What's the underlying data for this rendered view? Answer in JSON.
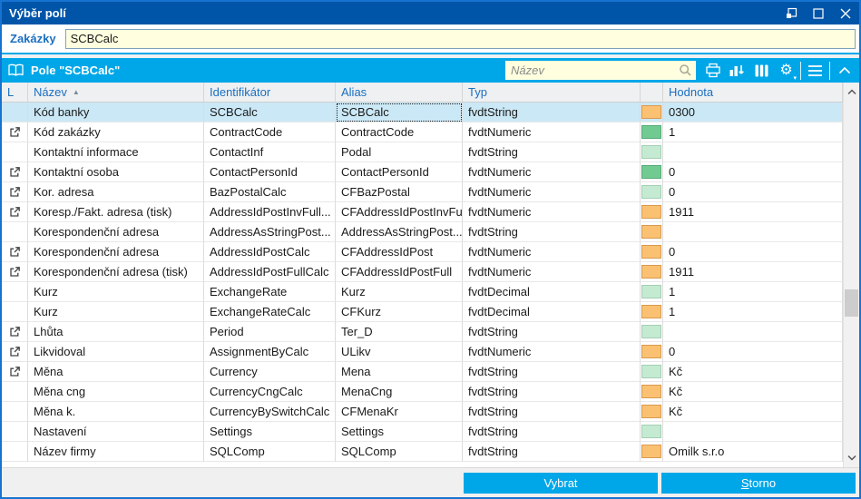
{
  "window": {
    "title": "Výběr polí"
  },
  "params": {
    "label": "Zakázky",
    "value": "SCBCalc"
  },
  "toolbar": {
    "panel_title": "Pole \"SCBCalc\"",
    "search_placeholder": "Název"
  },
  "buttons": {
    "vybrat": "Vybrat",
    "storno": "Storno"
  },
  "colors": {
    "window_border": "#1673d1",
    "titlebar": "#0055a9",
    "toolbar": "#00a7e8",
    "input_bg": "#ffffdf",
    "header_text": "#1b6fc0",
    "selected_row": "#cbe8f6",
    "swatches": {
      "orange": {
        "fill": "#fac172",
        "border": "#d99a4e"
      },
      "green": {
        "fill": "#72ca93",
        "border": "#55ab77"
      },
      "lightgreen": {
        "fill": "#c4ead2",
        "border": "#a4cfb4"
      }
    }
  },
  "table": {
    "headers": {
      "l": "L",
      "nazev": "Název",
      "identifikator": "Identifikátor",
      "alias": "Alias",
      "typ": "Typ",
      "hodnota": "Hodnota"
    },
    "sort": {
      "column": "Název",
      "direction": "ascending"
    },
    "rows": [
      {
        "link": false,
        "nazev": "Kód banky",
        "identifikator": "SCBCalc",
        "alias": "SCBCalc",
        "typ": "fvdtString",
        "swatch": "orange",
        "hodnota": "0300",
        "selected": true,
        "focused_cell": "alias"
      },
      {
        "link": true,
        "nazev": "Kód zakázky",
        "identifikator": "ContractCode",
        "alias": "ContractCode",
        "typ": "fvdtNumeric",
        "swatch": "green",
        "hodnota": "1"
      },
      {
        "link": false,
        "nazev": "Kontaktní informace",
        "identifikator": "ContactInf",
        "alias": "Podal",
        "typ": "fvdtString",
        "swatch": "lightgreen",
        "hodnota": ""
      },
      {
        "link": true,
        "nazev": "Kontaktní osoba",
        "identifikator": "ContactPersonId",
        "alias": "ContactPersonId",
        "typ": "fvdtNumeric",
        "swatch": "green",
        "hodnota": "0"
      },
      {
        "link": true,
        "nazev": "Kor. adresa",
        "identifikator": "BazPostalCalc",
        "alias": "CFBazPostal",
        "typ": "fvdtNumeric",
        "swatch": "lightgreen",
        "hodnota": "0"
      },
      {
        "link": true,
        "nazev": "Koresp./Fakt. adresa (tisk)",
        "identifikator": "AddressIdPostInvFull...",
        "alias": "CFAddressIdPostInvFull",
        "typ": "fvdtNumeric",
        "swatch": "orange",
        "hodnota": "1911"
      },
      {
        "link": false,
        "nazev": "Korespondenční adresa",
        "identifikator": "AddressAsStringPost...",
        "alias": "AddressAsStringPost...",
        "typ": "fvdtString",
        "swatch": "orange",
        "hodnota": ""
      },
      {
        "link": true,
        "nazev": "Korespondenční adresa",
        "identifikator": "AddressIdPostCalc",
        "alias": "CFAddressIdPost",
        "typ": "fvdtNumeric",
        "swatch": "orange",
        "hodnota": "0"
      },
      {
        "link": true,
        "nazev": "Korespondenční adresa (tisk)",
        "identifikator": "AddressIdPostFullCalc",
        "alias": "CFAddressIdPostFull",
        "typ": "fvdtNumeric",
        "swatch": "orange",
        "hodnota": "1911"
      },
      {
        "link": false,
        "nazev": "Kurz",
        "identifikator": "ExchangeRate",
        "alias": "Kurz",
        "typ": "fvdtDecimal",
        "swatch": "lightgreen",
        "hodnota": "1"
      },
      {
        "link": false,
        "nazev": "Kurz",
        "identifikator": "ExchangeRateCalc",
        "alias": "CFKurz",
        "typ": "fvdtDecimal",
        "swatch": "orange",
        "hodnota": "1"
      },
      {
        "link": true,
        "nazev": "Lhůta",
        "identifikator": "Period",
        "alias": "Ter_D",
        "typ": "fvdtString",
        "swatch": "lightgreen",
        "hodnota": ""
      },
      {
        "link": true,
        "nazev": "Likvidoval",
        "identifikator": "AssignmentByCalc",
        "alias": "ULikv",
        "typ": "fvdtNumeric",
        "swatch": "orange",
        "hodnota": "0"
      },
      {
        "link": true,
        "nazev": "Měna",
        "identifikator": "Currency",
        "alias": "Mena",
        "typ": "fvdtString",
        "swatch": "lightgreen",
        "hodnota": "Kč"
      },
      {
        "link": false,
        "nazev": "Měna cng",
        "identifikator": "CurrencyCngCalc",
        "alias": "MenaCng",
        "typ": "fvdtString",
        "swatch": "orange",
        "hodnota": "Kč"
      },
      {
        "link": false,
        "nazev": "Měna k.",
        "identifikator": "CurrencyBySwitchCalc",
        "alias": "CFMenaKr",
        "typ": "fvdtString",
        "swatch": "orange",
        "hodnota": "Kč"
      },
      {
        "link": false,
        "nazev": "Nastavení",
        "identifikator": "Settings",
        "alias": "Settings",
        "typ": "fvdtString",
        "swatch": "lightgreen",
        "hodnota": ""
      },
      {
        "link": false,
        "nazev": "Název firmy",
        "identifikator": "SQLComp",
        "alias": "SQLComp",
        "typ": "fvdtString",
        "swatch": "orange",
        "hodnota": "Omilk s.r.o"
      }
    ]
  }
}
